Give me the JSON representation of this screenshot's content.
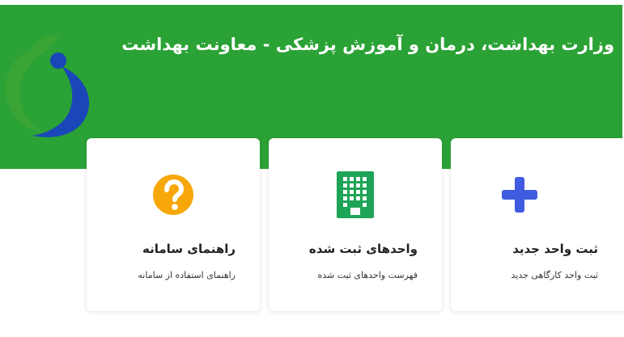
{
  "header": {
    "title": "وزارت بهداشت، درمان و آموزش پزشکی - معاونت بهداشت",
    "logo_icon": "ministry-health-logo-icon"
  },
  "cards": [
    {
      "title": "ثبت واحد جدید",
      "description": "ثبت واحد کارگاهی جدید",
      "icon": "plus-icon",
      "icon_color": "#3f5be0"
    },
    {
      "title": "واحدهای ثبت شده",
      "description": "فهرست واحدهای ثبت شده",
      "icon": "building-icon",
      "icon_color": "#1ea457"
    },
    {
      "title": "راهنمای سامانه",
      "description": "راهنمای استفاده از سامانه",
      "icon": "question-icon",
      "icon_color": "#f7a70a"
    }
  ],
  "colors": {
    "banner": "#2ba236",
    "logo_green": "#3aa535",
    "logo_blue": "#1a47b8"
  }
}
